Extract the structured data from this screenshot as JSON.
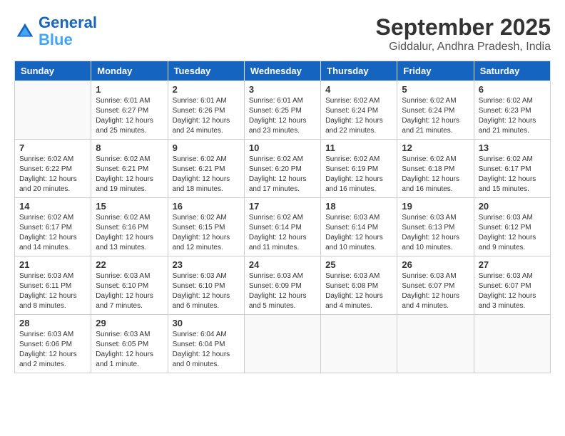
{
  "header": {
    "logo_line1": "General",
    "logo_line2": "Blue",
    "month": "September 2025",
    "location": "Giddalur, Andhra Pradesh, India"
  },
  "weekdays": [
    "Sunday",
    "Monday",
    "Tuesday",
    "Wednesday",
    "Thursday",
    "Friday",
    "Saturday"
  ],
  "weeks": [
    [
      {
        "day": "",
        "detail": ""
      },
      {
        "day": "1",
        "detail": "Sunrise: 6:01 AM\nSunset: 6:27 PM\nDaylight: 12 hours\nand 25 minutes."
      },
      {
        "day": "2",
        "detail": "Sunrise: 6:01 AM\nSunset: 6:26 PM\nDaylight: 12 hours\nand 24 minutes."
      },
      {
        "day": "3",
        "detail": "Sunrise: 6:01 AM\nSunset: 6:25 PM\nDaylight: 12 hours\nand 23 minutes."
      },
      {
        "day": "4",
        "detail": "Sunrise: 6:02 AM\nSunset: 6:24 PM\nDaylight: 12 hours\nand 22 minutes."
      },
      {
        "day": "5",
        "detail": "Sunrise: 6:02 AM\nSunset: 6:24 PM\nDaylight: 12 hours\nand 21 minutes."
      },
      {
        "day": "6",
        "detail": "Sunrise: 6:02 AM\nSunset: 6:23 PM\nDaylight: 12 hours\nand 21 minutes."
      }
    ],
    [
      {
        "day": "7",
        "detail": "Sunrise: 6:02 AM\nSunset: 6:22 PM\nDaylight: 12 hours\nand 20 minutes."
      },
      {
        "day": "8",
        "detail": "Sunrise: 6:02 AM\nSunset: 6:21 PM\nDaylight: 12 hours\nand 19 minutes."
      },
      {
        "day": "9",
        "detail": "Sunrise: 6:02 AM\nSunset: 6:21 PM\nDaylight: 12 hours\nand 18 minutes."
      },
      {
        "day": "10",
        "detail": "Sunrise: 6:02 AM\nSunset: 6:20 PM\nDaylight: 12 hours\nand 17 minutes."
      },
      {
        "day": "11",
        "detail": "Sunrise: 6:02 AM\nSunset: 6:19 PM\nDaylight: 12 hours\nand 16 minutes."
      },
      {
        "day": "12",
        "detail": "Sunrise: 6:02 AM\nSunset: 6:18 PM\nDaylight: 12 hours\nand 16 minutes."
      },
      {
        "day": "13",
        "detail": "Sunrise: 6:02 AM\nSunset: 6:17 PM\nDaylight: 12 hours\nand 15 minutes."
      }
    ],
    [
      {
        "day": "14",
        "detail": "Sunrise: 6:02 AM\nSunset: 6:17 PM\nDaylight: 12 hours\nand 14 minutes."
      },
      {
        "day": "15",
        "detail": "Sunrise: 6:02 AM\nSunset: 6:16 PM\nDaylight: 12 hours\nand 13 minutes."
      },
      {
        "day": "16",
        "detail": "Sunrise: 6:02 AM\nSunset: 6:15 PM\nDaylight: 12 hours\nand 12 minutes."
      },
      {
        "day": "17",
        "detail": "Sunrise: 6:02 AM\nSunset: 6:14 PM\nDaylight: 12 hours\nand 11 minutes."
      },
      {
        "day": "18",
        "detail": "Sunrise: 6:03 AM\nSunset: 6:14 PM\nDaylight: 12 hours\nand 10 minutes."
      },
      {
        "day": "19",
        "detail": "Sunrise: 6:03 AM\nSunset: 6:13 PM\nDaylight: 12 hours\nand 10 minutes."
      },
      {
        "day": "20",
        "detail": "Sunrise: 6:03 AM\nSunset: 6:12 PM\nDaylight: 12 hours\nand 9 minutes."
      }
    ],
    [
      {
        "day": "21",
        "detail": "Sunrise: 6:03 AM\nSunset: 6:11 PM\nDaylight: 12 hours\nand 8 minutes."
      },
      {
        "day": "22",
        "detail": "Sunrise: 6:03 AM\nSunset: 6:10 PM\nDaylight: 12 hours\nand 7 minutes."
      },
      {
        "day": "23",
        "detail": "Sunrise: 6:03 AM\nSunset: 6:10 PM\nDaylight: 12 hours\nand 6 minutes."
      },
      {
        "day": "24",
        "detail": "Sunrise: 6:03 AM\nSunset: 6:09 PM\nDaylight: 12 hours\nand 5 minutes."
      },
      {
        "day": "25",
        "detail": "Sunrise: 6:03 AM\nSunset: 6:08 PM\nDaylight: 12 hours\nand 4 minutes."
      },
      {
        "day": "26",
        "detail": "Sunrise: 6:03 AM\nSunset: 6:07 PM\nDaylight: 12 hours\nand 4 minutes."
      },
      {
        "day": "27",
        "detail": "Sunrise: 6:03 AM\nSunset: 6:07 PM\nDaylight: 12 hours\nand 3 minutes."
      }
    ],
    [
      {
        "day": "28",
        "detail": "Sunrise: 6:03 AM\nSunset: 6:06 PM\nDaylight: 12 hours\nand 2 minutes."
      },
      {
        "day": "29",
        "detail": "Sunrise: 6:03 AM\nSunset: 6:05 PM\nDaylight: 12 hours\nand 1 minute."
      },
      {
        "day": "30",
        "detail": "Sunrise: 6:04 AM\nSunset: 6:04 PM\nDaylight: 12 hours\nand 0 minutes."
      },
      {
        "day": "",
        "detail": ""
      },
      {
        "day": "",
        "detail": ""
      },
      {
        "day": "",
        "detail": ""
      },
      {
        "day": "",
        "detail": ""
      }
    ]
  ]
}
